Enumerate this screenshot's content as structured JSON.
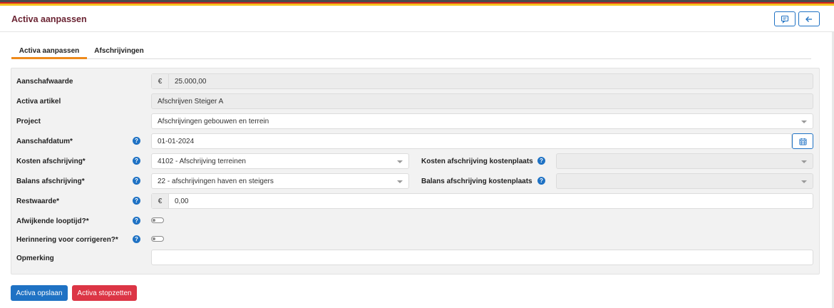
{
  "header": {
    "title": "Activa aanpassen",
    "buttons": [
      {
        "icon": "comment-icon"
      },
      {
        "icon": "arrow-left-icon"
      }
    ]
  },
  "tabs": [
    {
      "label": "Activa aanpassen",
      "active": true
    },
    {
      "label": "Afschrijvingen",
      "active": false
    }
  ],
  "form": {
    "aanschafwaarde": {
      "label": "Aanschafwaarde",
      "currency": "€",
      "value": "25.000,00"
    },
    "activa_artikel": {
      "label": "Activa artikel",
      "value": "Afschrijven Steiger A"
    },
    "project": {
      "label": "Project",
      "value": "Afschrijvingen gebouwen en terrein"
    },
    "aanschafdatum": {
      "label": "Aanschafdatum*",
      "value": "01-01-2024"
    },
    "kosten_afschrijving": {
      "label": "Kosten afschrijving*",
      "value": "4102 - Afschrijving terreinen"
    },
    "kosten_kostenplaats": {
      "label": "Kosten afschrijving kostenplaats",
      "value": ""
    },
    "balans_afschrijving": {
      "label": "Balans afschrijving*",
      "value": "22 - afschrijvingen haven en steigers"
    },
    "balans_kostenplaats": {
      "label": "Balans afschrijving kostenplaats",
      "value": ""
    },
    "restwaarde": {
      "label": "Restwaarde*",
      "currency": "€",
      "value": "0,00"
    },
    "afwijkende_looptijd": {
      "label": "Afwijkende looptijd?*",
      "checked": false
    },
    "herinnering": {
      "label": "Herinnering voor corrigeren?*",
      "checked": false
    },
    "opmerking": {
      "label": "Opmerking",
      "value": ""
    }
  },
  "help_glyph": "?",
  "actions": {
    "save_label": "Activa opslaan",
    "stop_label": "Activa stopzetten"
  },
  "colors": {
    "primary": "#1f72c4",
    "danger": "#dc3545",
    "title": "#6b2433",
    "tab_accent": "#ee8a1c"
  }
}
